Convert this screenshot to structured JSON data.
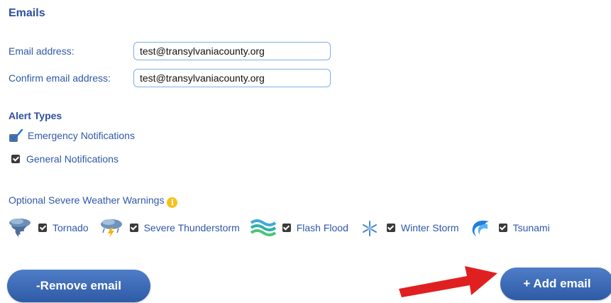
{
  "section_title": "Emails",
  "email": {
    "label": "Email address:",
    "value": "test@transylvaniacounty.org"
  },
  "confirm": {
    "label": "Confirm email address:",
    "value": "test@transylvaniacounty.org"
  },
  "alert_types": {
    "title": "Alert Types",
    "items": [
      {
        "label": "Emergency Notifications",
        "checked": true
      },
      {
        "label": "General Notifications",
        "checked": true
      }
    ]
  },
  "weather": {
    "title": "Optional Severe Weather Warnings",
    "info_icon": "info-icon",
    "items": [
      {
        "label": "Tornado",
        "icon": "tornado-icon",
        "checked": true
      },
      {
        "label": "Severe Thunderstorm",
        "icon": "thunderstorm-icon",
        "checked": true
      },
      {
        "label": "Flash Flood",
        "icon": "flood-icon",
        "checked": true
      },
      {
        "label": "Winter Storm",
        "icon": "snowflake-icon",
        "checked": true
      },
      {
        "label": "Tsunami",
        "icon": "tsunami-icon",
        "checked": true
      }
    ]
  },
  "buttons": {
    "remove": "-Remove email",
    "add": "+ Add email"
  },
  "colors": {
    "heading": "#2d4f9e",
    "label": "#2f58a8",
    "button": "#3f6cb8",
    "arrow": "#e02020"
  }
}
